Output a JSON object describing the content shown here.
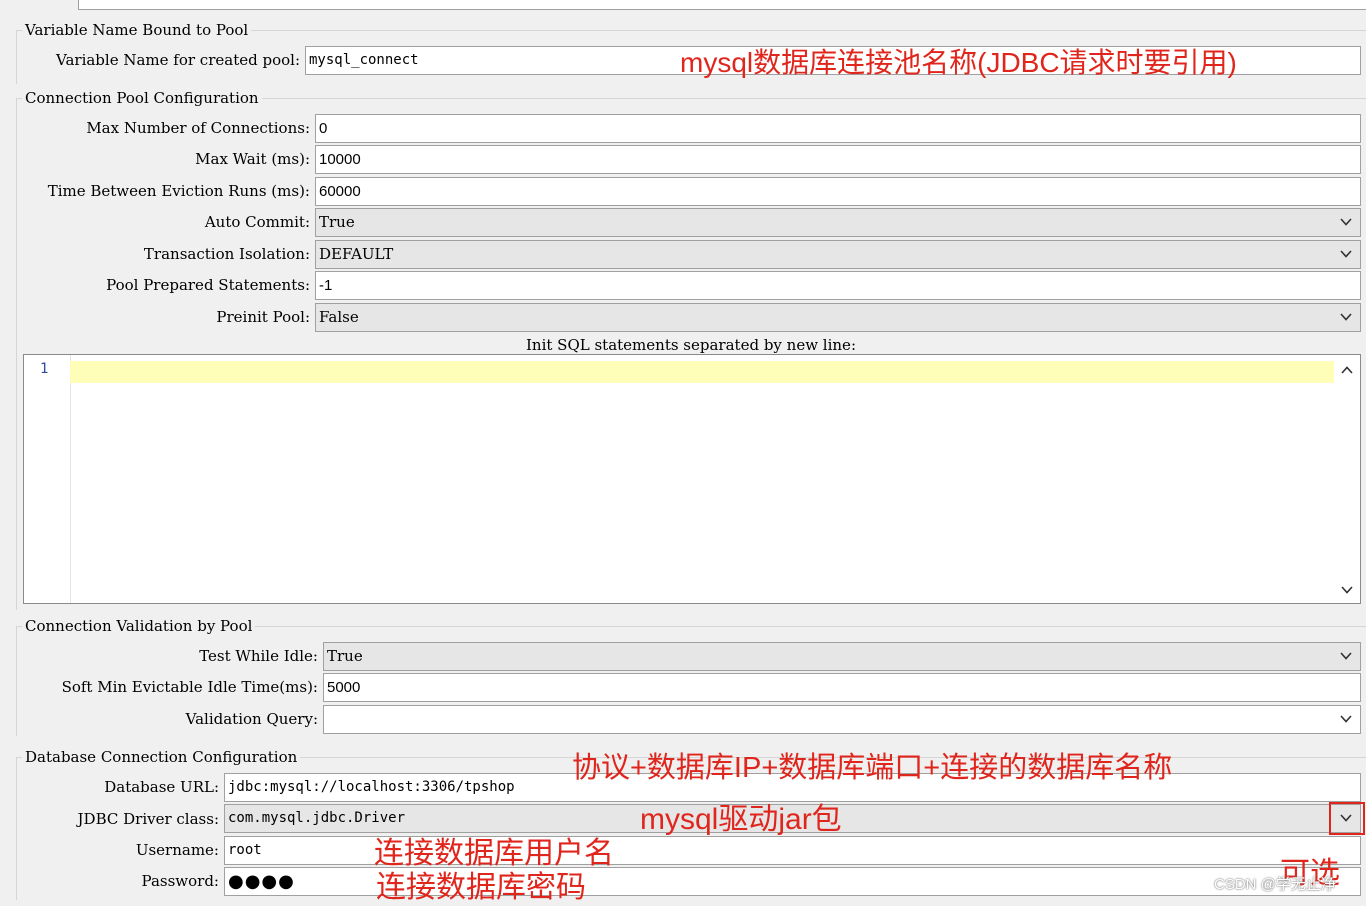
{
  "sections": {
    "variable_name": {
      "legend": "Variable Name Bound to Pool",
      "label": "Variable Name for created pool:",
      "value": "mysql_connect"
    },
    "pool_config": {
      "legend": "Connection Pool Configuration",
      "max_connections": {
        "label": "Max Number of Connections:",
        "value": "0"
      },
      "max_wait": {
        "label": "Max Wait (ms):",
        "value": "10000"
      },
      "eviction": {
        "label": "Time Between Eviction Runs (ms):",
        "value": "60000"
      },
      "auto_commit": {
        "label": "Auto Commit:",
        "value": "True"
      },
      "isolation": {
        "label": "Transaction Isolation:",
        "value": "DEFAULT"
      },
      "prepared": {
        "label": "Pool Prepared Statements:",
        "value": "-1"
      },
      "preinit": {
        "label": "Preinit Pool:",
        "value": "False"
      },
      "init_sql_label": "Init SQL statements separated by new line:",
      "line_number": "1"
    },
    "validation": {
      "legend": "Connection Validation by Pool",
      "test_idle": {
        "label": "Test While Idle:",
        "value": "True"
      },
      "soft_min": {
        "label": "Soft Min Evictable Idle Time(ms):",
        "value": "5000"
      },
      "query": {
        "label": "Validation Query:",
        "value": ""
      }
    },
    "database": {
      "legend": "Database Connection Configuration",
      "url": {
        "label": "Database URL:",
        "value": "jdbc:mysql://localhost:3306/tpshop"
      },
      "driver": {
        "label": "JDBC Driver class:",
        "value": "com.mysql.jdbc.Driver"
      },
      "username": {
        "label": "Username:",
        "value": "root"
      },
      "password": {
        "label": "Password:",
        "value": "●●●●"
      }
    }
  },
  "annotations": {
    "pool_name": "mysql数据库连接池名称(JDBC请求时要引用)",
    "url": "协议+数据库IP+数据库端口+连接的数据库名称",
    "driver": "mysql驱动jar包",
    "username": "连接数据库用户名",
    "password": "连接数据库密码",
    "optional": "可选"
  },
  "watermark": "CSDN @学无止净",
  "colors": {
    "annotation_red": "#e0261c",
    "current_line": "#fefeb9",
    "line_number": "#2a4ba0"
  }
}
